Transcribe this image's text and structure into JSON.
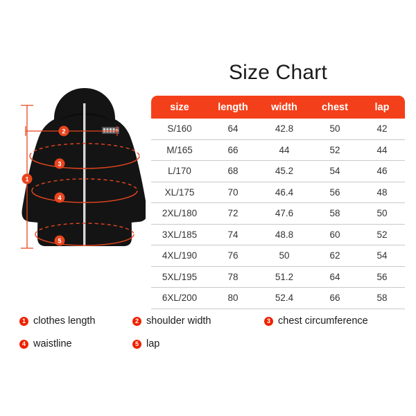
{
  "title": "Size Chart",
  "colors": {
    "header_bg": "#f4401a",
    "badge_red": "#ee2200",
    "marker_orange": "#e8451f",
    "jacket_black": "#141414",
    "background": "#ffffff",
    "row_divider": "#c9c9c9"
  },
  "table": {
    "columns": [
      "size",
      "length",
      "width",
      "chest",
      "lap"
    ],
    "rows": [
      [
        "S/160",
        "64",
        "42.8",
        "50",
        "42"
      ],
      [
        "M/165",
        "66",
        "44",
        "52",
        "44"
      ],
      [
        "L/170",
        "68",
        "45.2",
        "54",
        "46"
      ],
      [
        "XL/175",
        "70",
        "46.4",
        "56",
        "48"
      ],
      [
        "2XL/180",
        "72",
        "47.6",
        "58",
        "50"
      ],
      [
        "3XL/185",
        "74",
        "48.8",
        "60",
        "52"
      ],
      [
        "4XL/190",
        "76",
        "50",
        "62",
        "54"
      ],
      [
        "5XL/195",
        "78",
        "51.2",
        "64",
        "56"
      ],
      [
        "6XL/200",
        "80",
        "52.4",
        "66",
        "58"
      ]
    ]
  },
  "legend": [
    {
      "number": "1",
      "label": "clothes length"
    },
    {
      "number": "2",
      "label": "shoulder width"
    },
    {
      "number": "3",
      "label": "chest circumference"
    },
    {
      "number": "4",
      "label": "waistline"
    },
    {
      "number": "5",
      "label": "lap"
    }
  ],
  "illustration": {
    "markers": [
      "1",
      "2",
      "3",
      "4",
      "5"
    ],
    "garment": "hooded-jacket"
  }
}
